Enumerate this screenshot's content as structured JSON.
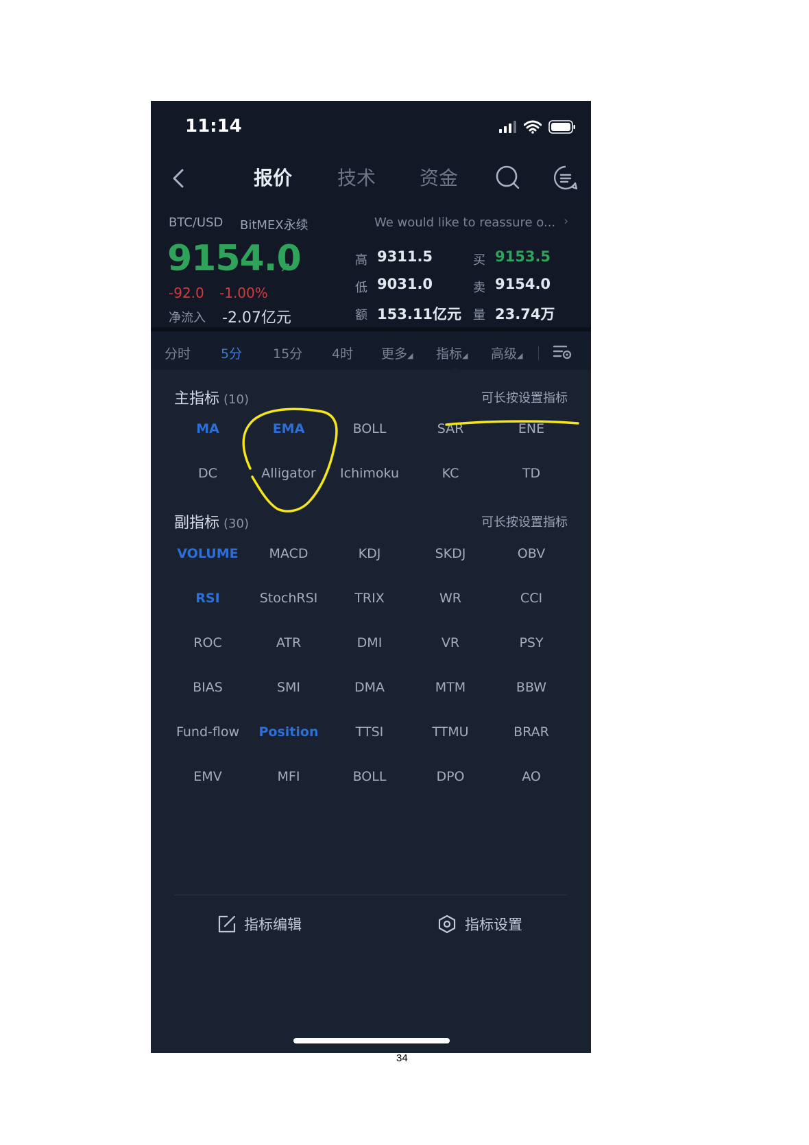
{
  "status": {
    "time": "11:14"
  },
  "nav": {
    "tabs": [
      "报价",
      "技术",
      "资金"
    ]
  },
  "market": {
    "pair": "BTC/USD",
    "exchange": "BitMEX永续",
    "news": "We would like to reassure o...",
    "price": "9154.0",
    "change": "-92.0",
    "change_pct": "-1.00%",
    "inflow_label": "净流入",
    "inflow_value": "-2.07亿元",
    "stats": {
      "high_label": "高",
      "high": "9311.5",
      "low_label": "低",
      "low": "9031.0",
      "amount_label": "额",
      "amount": "153.11亿元",
      "bid_label": "买",
      "bid": "9153.5",
      "ask_label": "卖",
      "ask": "9154.0",
      "volume_label": "量",
      "volume": "23.74万"
    }
  },
  "periods": [
    "分时",
    "5分",
    "15分",
    "4时",
    "更多",
    "指标",
    "高级"
  ],
  "main_indicators": {
    "title": "主指标",
    "count": "(10)",
    "hint": "可长按设置指标",
    "rows": [
      [
        "MA",
        "EMA",
        "BOLL",
        "SAR",
        "ENE"
      ],
      [
        "DC",
        "Alligator",
        "Ichimoku",
        "KC",
        "TD"
      ]
    ]
  },
  "sub_indicators": {
    "title": "副指标",
    "count": "(30)",
    "hint": "可长按设置指标",
    "rows": [
      [
        "VOLUME",
        "MACD",
        "KDJ",
        "SKDJ",
        "OBV"
      ],
      [
        "RSI",
        "StochRSI",
        "TRIX",
        "WR",
        "CCI"
      ],
      [
        "ROC",
        "ATR",
        "DMI",
        "VR",
        "PSY"
      ],
      [
        "BIAS",
        "SMI",
        "DMA",
        "MTM",
        "BBW"
      ],
      [
        "Fund-flow",
        "Position",
        "TTSI",
        "TTMU",
        "BRAR"
      ],
      [
        "EMV",
        "MFI",
        "BOLL",
        "DPO",
        "AO"
      ]
    ]
  },
  "bottom": {
    "edit": "指标编辑",
    "settings": "指标设置"
  },
  "page_number": "34",
  "colors": {
    "accent": "#2d6fd6",
    "up": "#2fa35a",
    "down": "#d33a3a",
    "annotation": "#f5e61c",
    "background": "#121826"
  }
}
